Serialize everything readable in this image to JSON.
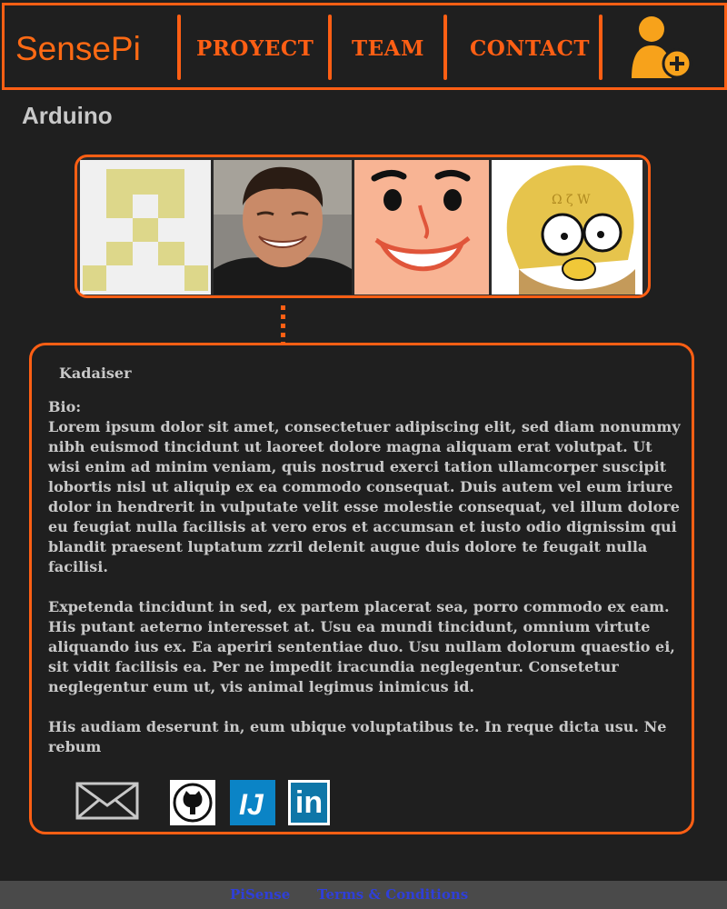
{
  "header": {
    "brand": "SensePi",
    "nav": [
      "PROYECT",
      "TEAM",
      "CONTACT"
    ],
    "add_user_icon": "add-user-icon"
  },
  "page": {
    "title": "Arduino"
  },
  "team_strip": {
    "members": [
      "identicon-avatar",
      "photo-avatar",
      "cartoon-face-avatar",
      "homer-wikipedia-avatar"
    ]
  },
  "card": {
    "name": "Kadaiser",
    "bio_label": "Bio:",
    "bio_paragraphs": [
      "Lorem ipsum dolor sit amet, consectetuer adipiscing elit, sed diam nonummy nibh euismod tincidunt ut laoreet dolore magna aliquam erat volutpat. Ut wisi enim ad minim veniam, quis nostrud exerci tation ullamcorper suscipit lobortis nisl ut aliquip ex ea commodo consequat. Duis autem vel eum iriure dolor in hendrerit in vulputate velit esse molestie consequat, vel illum dolore eu feugiat nulla facilisis at vero eros et accumsan et iusto odio dignissim qui blandit praesent luptatum zzril delenit augue duis dolore te feugait nulla facilisi.",
      "Expetenda tincidunt in sed, ex partem placerat sea, porro commodo ex eam. His putant aeterno interesset at. Usu ea mundi tincidunt, omnium virtute aliquando ius ex. Ea aperiri sententiae duo. Usu nullam dolorum quaestio ei, sit vidit facilisis ea. Per ne impedit iracundia neglegentur. Consetetur neglegentur eum ut, vis animal legimus inimicus id.",
      "His audiam deserunt in, eum ubique voluptatibus te. In reque dicta usu. Ne rebum"
    ],
    "social": [
      "mail-icon",
      "github-icon",
      "intellij-icon"
    ],
    "linkedin_text": "in"
  },
  "footer": {
    "links": [
      "PiSense",
      "Terms & Conditions"
    ]
  },
  "colors": {
    "accent": "#ff5f14",
    "background": "#1f1f1f",
    "text": "#c8c8c8",
    "footer_link": "#2f3fd9"
  }
}
